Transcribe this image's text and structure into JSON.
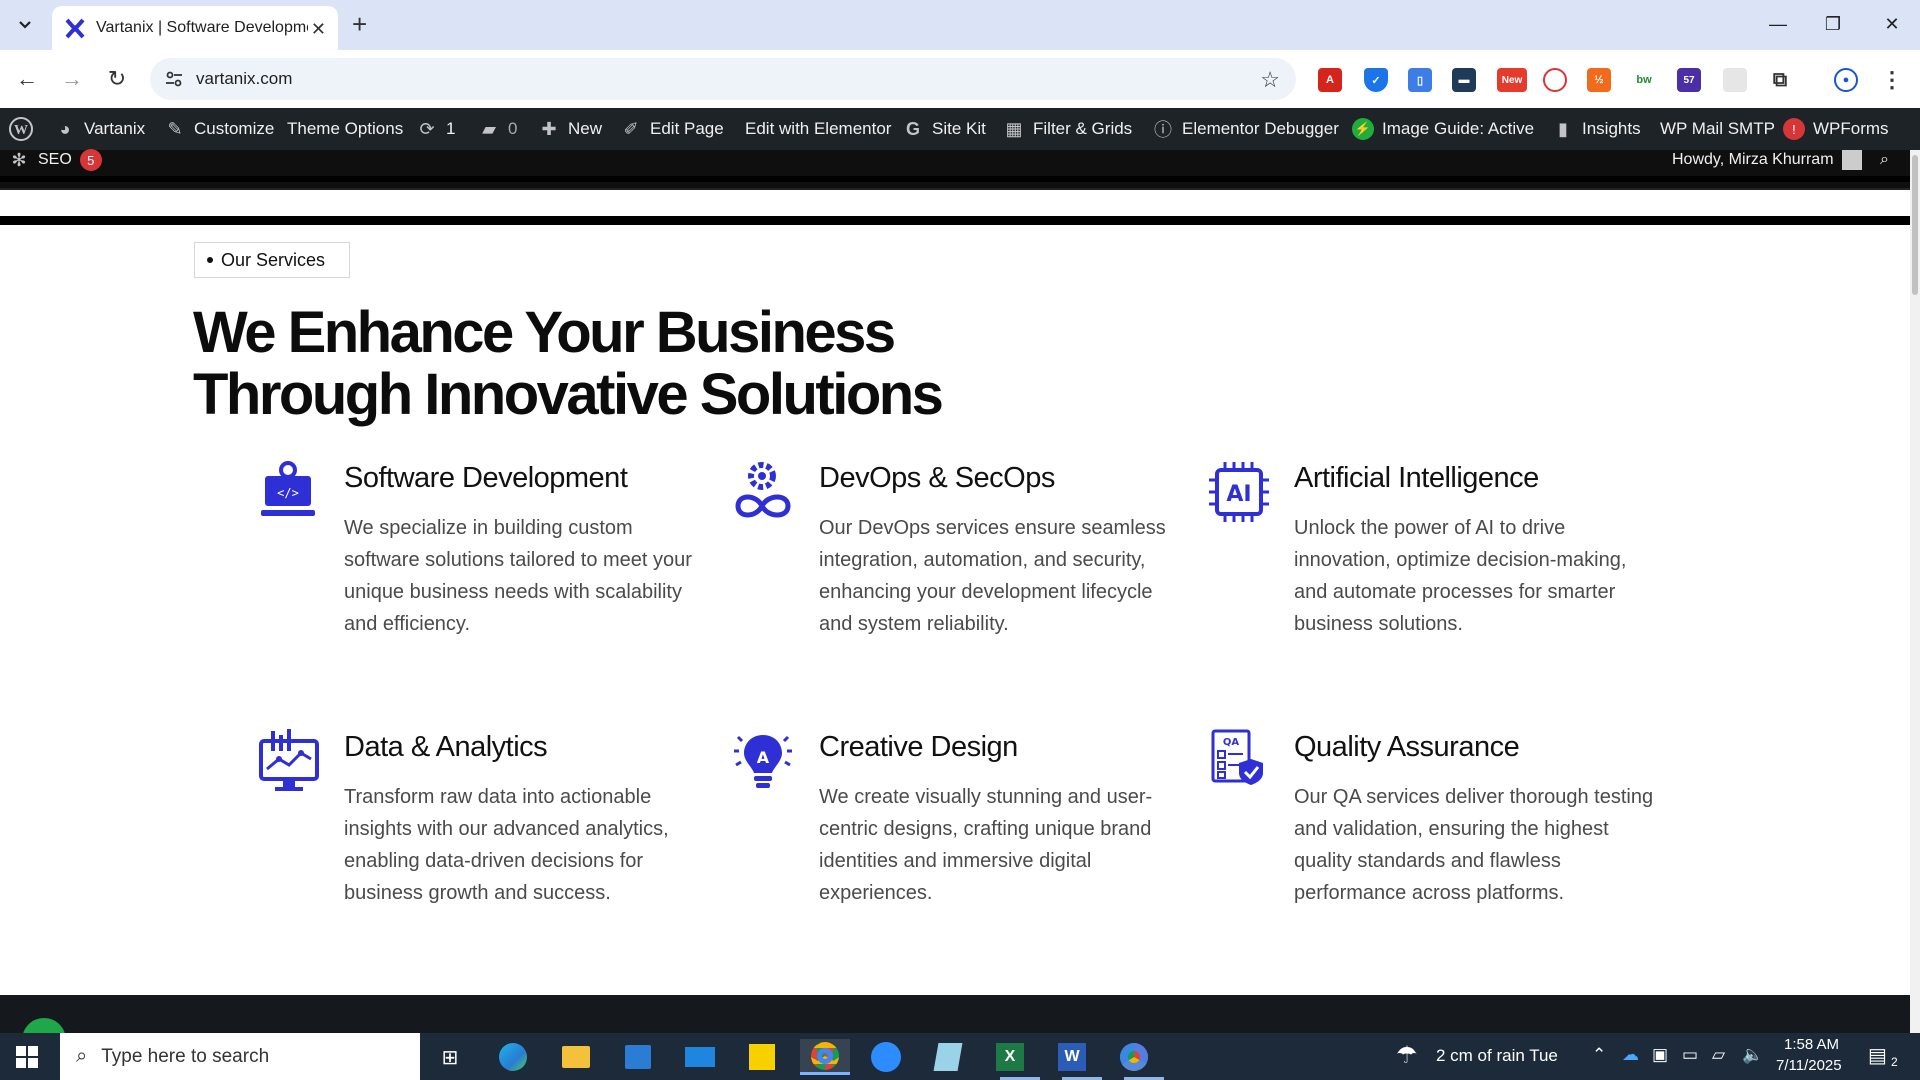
{
  "browser": {
    "tab_title": "Vartanix | Software Development",
    "url": "vartanix.com"
  },
  "admin_bar": {
    "site_name": "Vartanix",
    "customize": "Customize",
    "theme_options": "Theme Options",
    "updates_count": "1",
    "comments_count": "0",
    "new": "New",
    "edit_page": "Edit Page",
    "edit_elementor": "Edit with Elementor",
    "site_kit": "Site Kit",
    "filter_grids": "Filter & Grids",
    "elementor_debugger": "Elementor Debugger",
    "image_guide": "Image Guide: Active",
    "insights": "Insights",
    "wp_mail": "WP Mail SMTP",
    "wp_mail_badge": "!",
    "wpforms": "WPForms",
    "seo": "SEO",
    "seo_badge": "5",
    "howdy": "Howdy, Mirza Khurram"
  },
  "page": {
    "section_label": "Our Services",
    "hero_line1": "We Enhance Your Business",
    "hero_line2": "Through Innovative Solutions",
    "services": [
      {
        "title": "Software Development",
        "description": "We specialize in building custom software solutions tailored to meet your unique business needs with scalability and efficiency.",
        "icon": "laptop-code-icon"
      },
      {
        "title": "DevOps & SecOps",
        "description": "Our DevOps services ensure seamless integration, automation, and security, enhancing your development lifecycle and system reliability.",
        "icon": "gear-infinity-icon"
      },
      {
        "title": "Artificial Intelligence",
        "description": "Unlock the power of AI to drive innovation, optimize decision-making, and automate processes for smarter business solutions.",
        "icon": "ai-chip-icon"
      },
      {
        "title": "Data & Analytics",
        "description": "Transform raw data into actionable insights with our advanced analytics, enabling data-driven decisions for business growth and success.",
        "icon": "analytics-monitor-icon"
      },
      {
        "title": "Creative Design",
        "description": "We create visually stunning and user-centric designs, crafting unique brand identities and immersive digital experiences.",
        "icon": "lightbulb-icon"
      },
      {
        "title": "Quality Assurance",
        "description": "Our QA services deliver thorough testing and validation, ensuring the highest quality standards and flawless performance across platforms.",
        "icon": "qa-checklist-icon"
      }
    ],
    "accent_color": "#2f2fd6"
  },
  "taskbar": {
    "search_placeholder": "Type here to search",
    "weather": "2 cm of rain Tue",
    "time": "1:58 AM",
    "date": "7/11/2025",
    "notification_count": "2"
  },
  "extensions": {
    "new_badge": "New",
    "bw_label": "bw",
    "count_badge": "57"
  }
}
